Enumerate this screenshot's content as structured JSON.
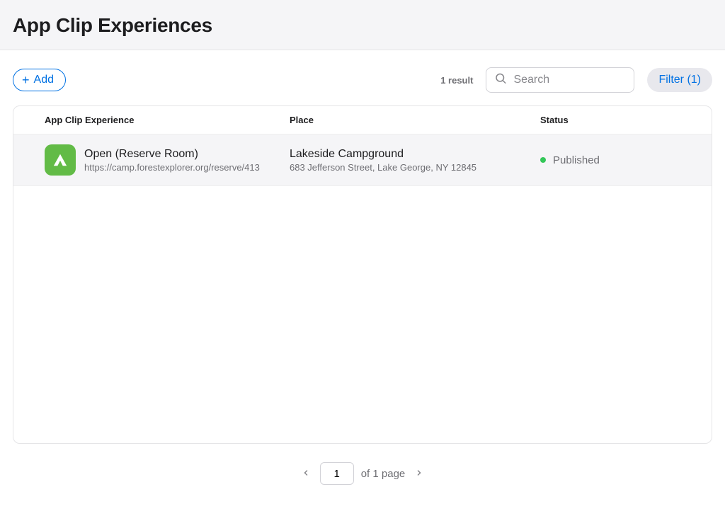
{
  "header": {
    "title": "App Clip Experiences"
  },
  "toolbar": {
    "add_label": "Add",
    "result_count_text": "1 result",
    "search_placeholder": "Search",
    "filter_label": "Filter (1)"
  },
  "table": {
    "headers": {
      "experience": "App Clip Experience",
      "place": "Place",
      "status": "Status"
    },
    "rows": [
      {
        "title": "Open (Reserve Room)",
        "url": "https://camp.forestexplorer.org/reserve/413",
        "place_name": "Lakeside Campground",
        "place_address": "683 Jefferson Street, Lake George, NY 12845",
        "status_label": "Published",
        "status_color": "#34c759",
        "icon_bg": "#62bb46"
      }
    ]
  },
  "pagination": {
    "current": "1",
    "total_text": "of 1 page"
  }
}
